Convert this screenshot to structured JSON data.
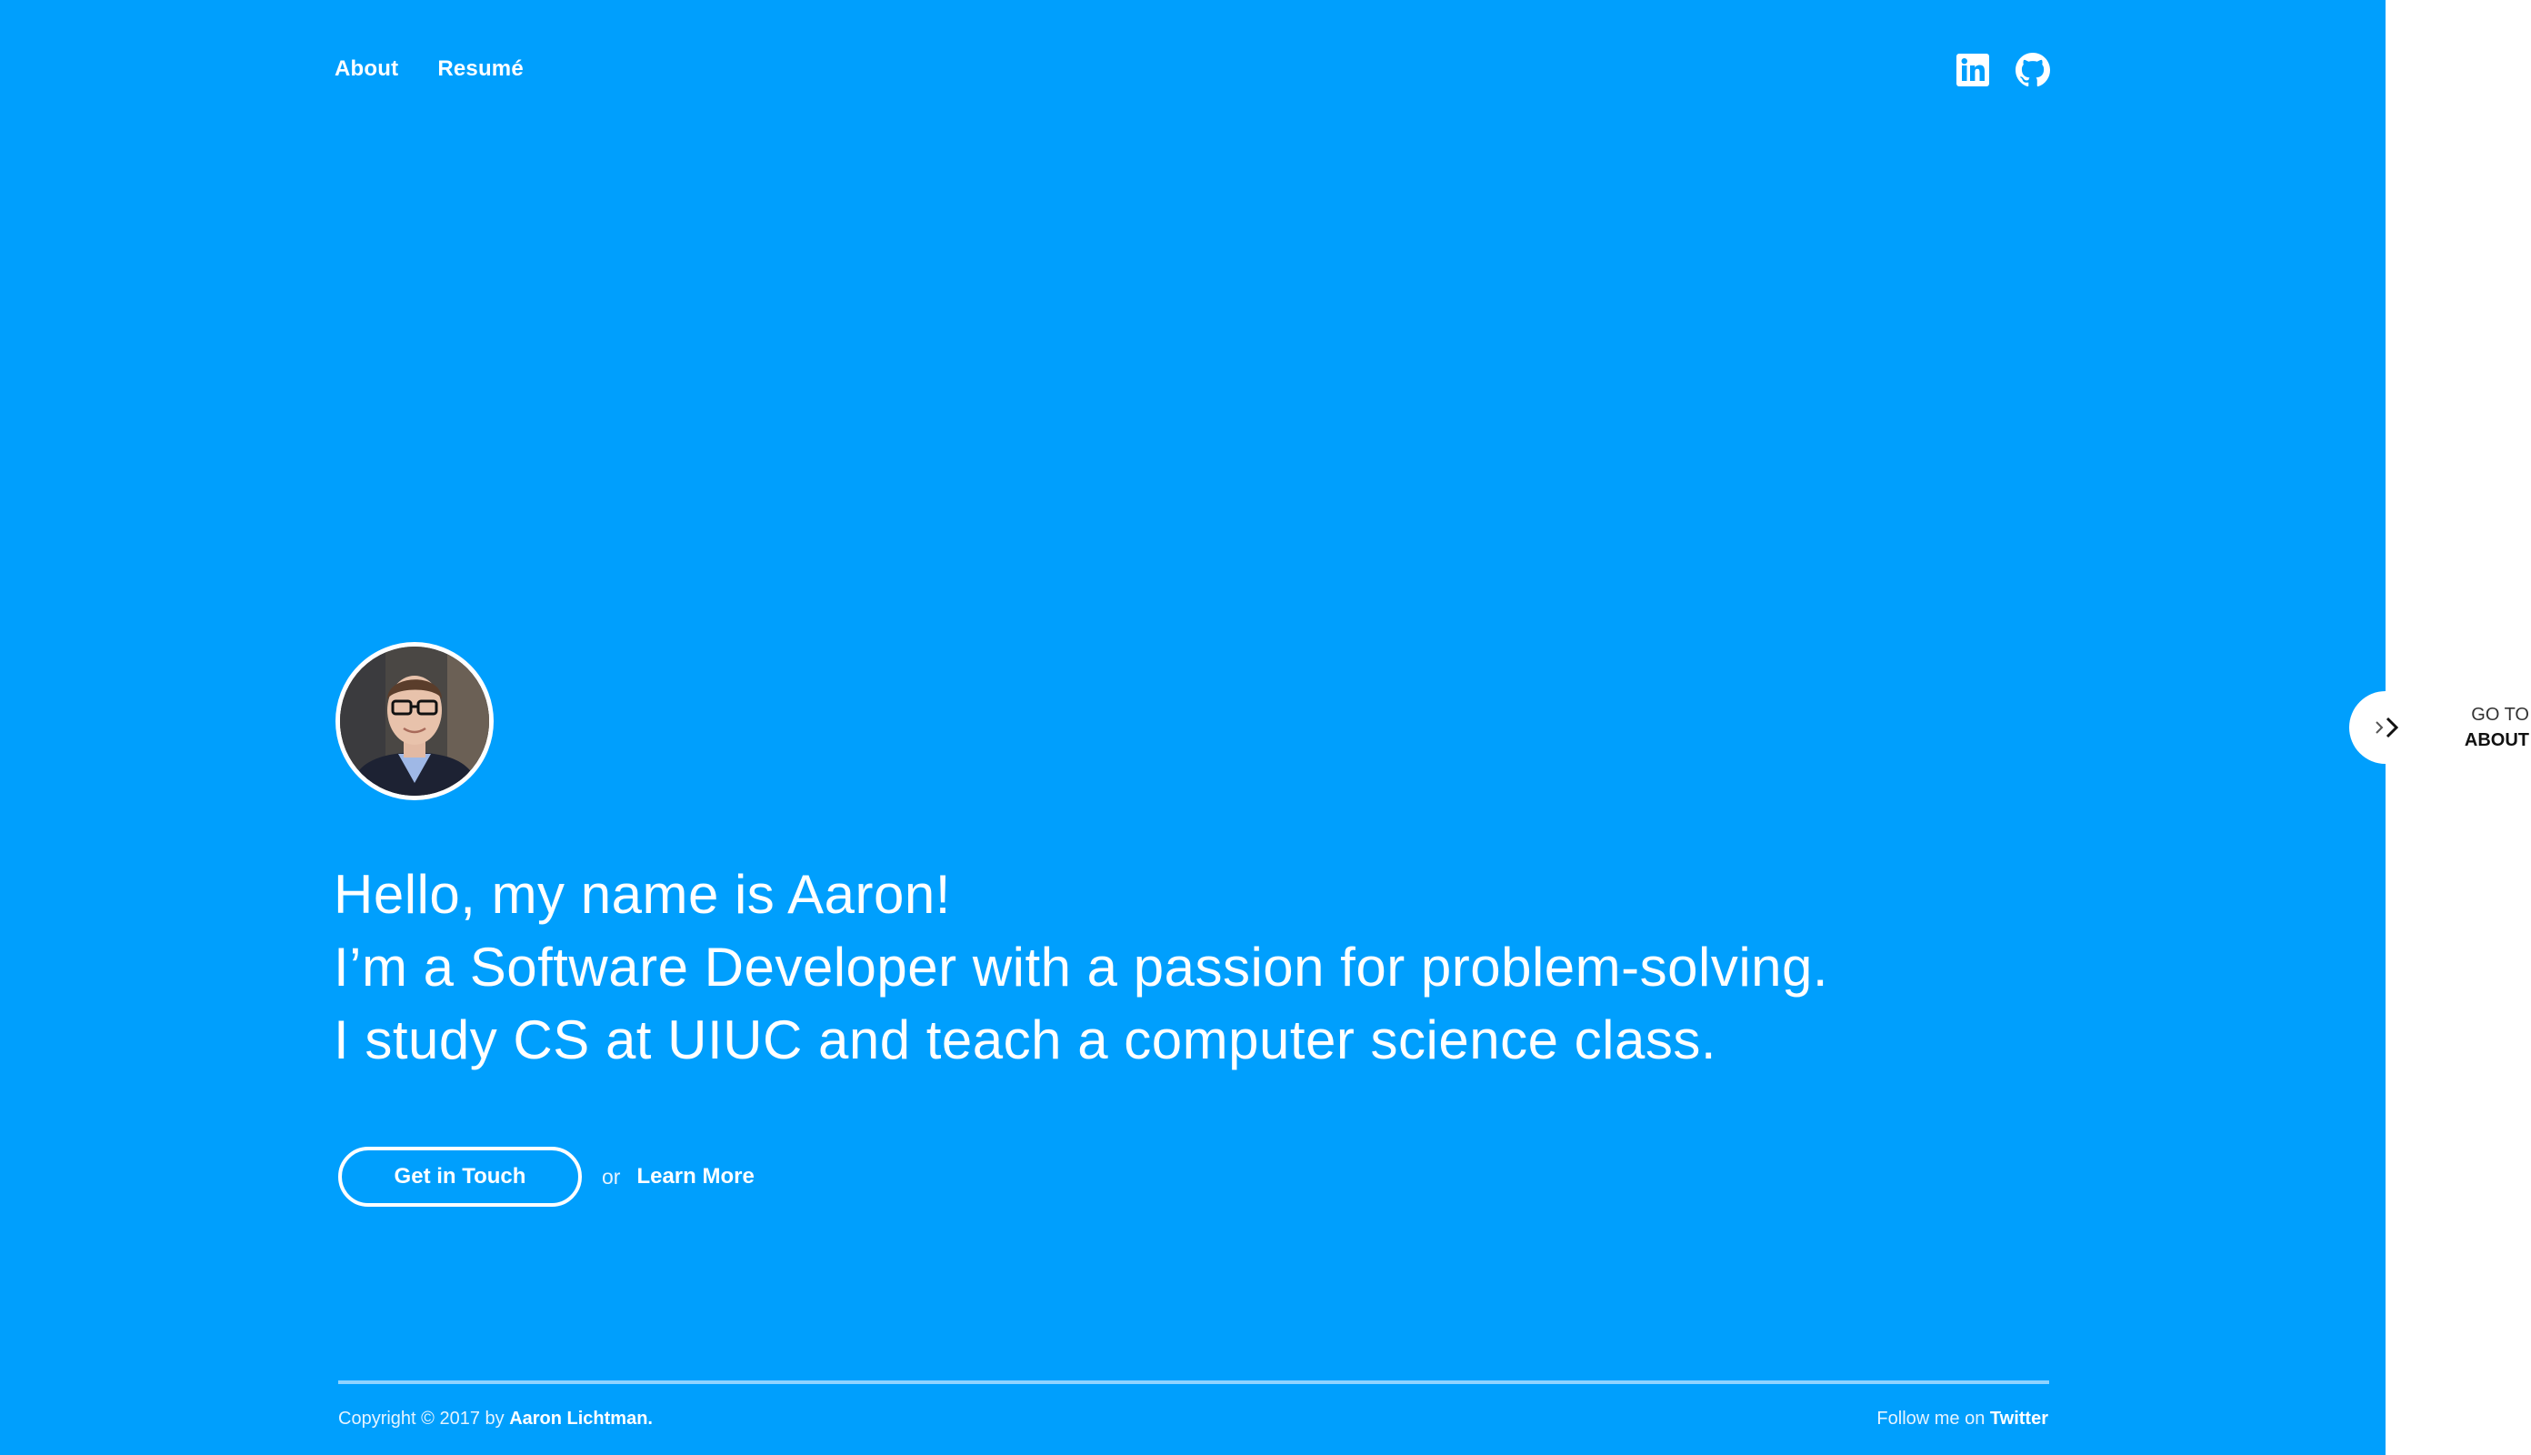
{
  "colors": {
    "hero_background": "#009ffd",
    "text_on_hero": "#ffffff",
    "page_background": "#ffffff"
  },
  "nav": {
    "items": [
      {
        "label": "About"
      },
      {
        "label": "Resumé"
      }
    ]
  },
  "social": {
    "icons": [
      "linkedin-icon",
      "github-icon"
    ]
  },
  "intro": {
    "line1": "Hello, my name is Aaron!",
    "line2": "I’m a Software Developer with a passion for problem-solving.",
    "line3": "I study CS at UIUC and teach a computer science class."
  },
  "actions": {
    "primary_label": "Get in Touch",
    "separator": "or",
    "secondary_label": "Learn More"
  },
  "footer": {
    "copyright_prefix": "Copyright © 2017 by ",
    "author": "Aaron Lichtman.",
    "follow_prefix": "Follow me on ",
    "follow_link": "Twitter"
  },
  "side_tab": {
    "line1": "GO TO",
    "line2": "ABOUT",
    "icon": "double-chevron-right-icon"
  }
}
